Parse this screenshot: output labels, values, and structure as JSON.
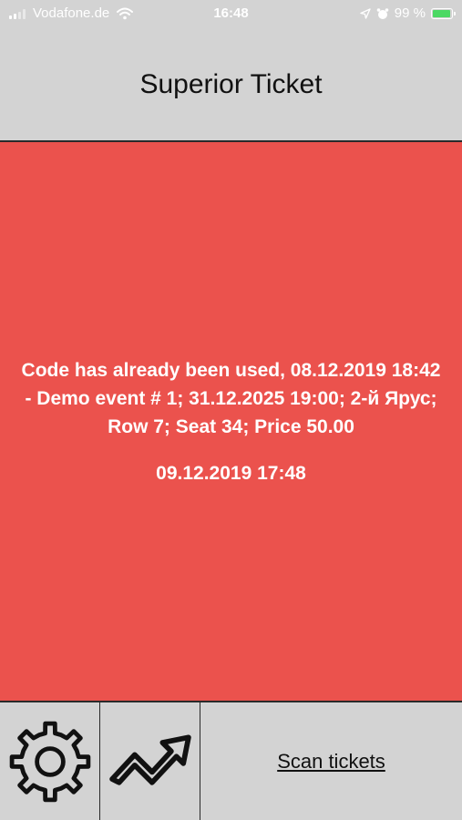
{
  "status_bar": {
    "carrier": "Vodafone.de",
    "time": "16:48",
    "battery_percent": "99 %",
    "battery_level": 0.99
  },
  "header": {
    "title": "Superior Ticket"
  },
  "result": {
    "message": "Code has already been used, 08.12.2019 18:42\n- Demo event # 1; 31.12.2025 19:00; 2-й Ярус; Row 7; Seat 34; Price 50.00",
    "timestamp": "09.12.2019 17:48",
    "status_color": "#eb524d"
  },
  "bottom_bar": {
    "settings_icon": "gear-icon",
    "stats_icon": "trend-arrow-icon",
    "scan_label": "Scan tickets"
  }
}
